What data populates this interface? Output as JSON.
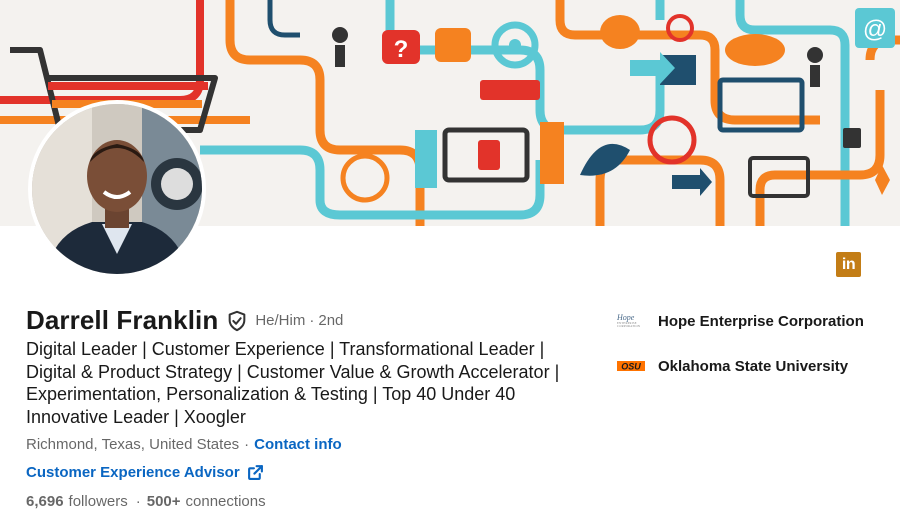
{
  "profile": {
    "name": "Darrell Franklin",
    "pronouns": "He/Him",
    "separator": "·",
    "degree": "2nd",
    "headline": "Digital Leader | Customer Experience | Transformational Leader | Digital & Product Strategy | Customer Value & Growth Accelerator | Experimentation, Personalization & Testing | Top 40 Under 40 Innovative Leader | Xoogler",
    "location": "Richmond, Texas, United States",
    "dot": "·",
    "contact_label": "Contact info",
    "website_label": "Customer Experience Advisor",
    "followers_count": "6,696",
    "followers_label": "followers",
    "connections_dot": "·",
    "connections_count": "500+",
    "connections_label": "connections"
  },
  "organizations": [
    {
      "name": "Hope Enterprise Corporation",
      "logo_text": "Hope",
      "logo_subtext": "ENTERPRISE CORPORATION"
    },
    {
      "name": "Oklahoma State University",
      "logo_text": "OSU"
    }
  ],
  "brand_logo": {
    "text": "in"
  },
  "colors": {
    "link_blue": "#0a66c2",
    "brand_badge": "#c37d16",
    "banner_orange": "#f58220",
    "banner_teal": "#5bc8d4",
    "banner_navy": "#1f4f6e",
    "banner_red": "#e2332a"
  },
  "icons": {
    "verified": "shield-check-icon",
    "external": "external-link-icon",
    "brand": "linkedin-icon"
  }
}
